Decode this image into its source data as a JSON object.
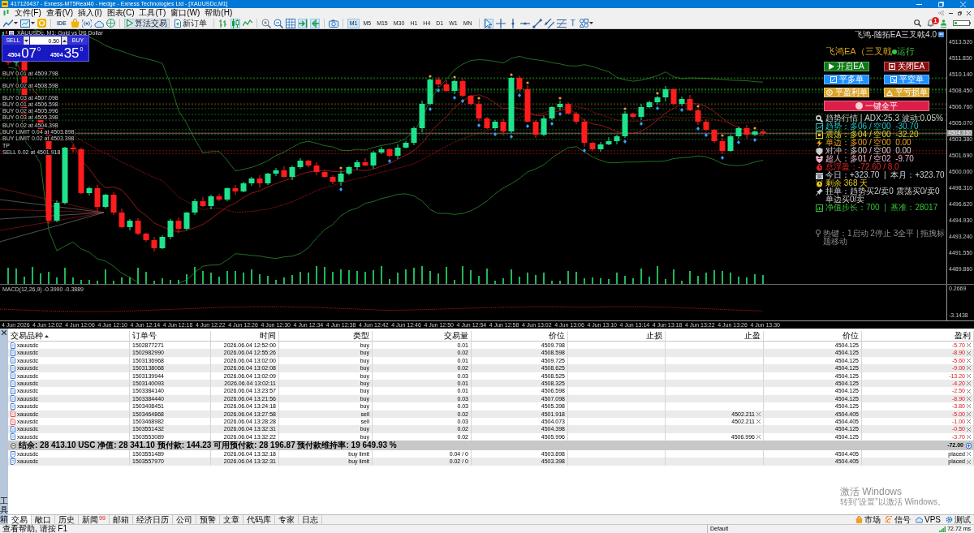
{
  "window": {
    "title": "417120437 - Exness-MT5Real40 - Hedge - Exness Technologies Ltd - [XAUUSDc,M1]"
  },
  "menu": [
    "文件(F)",
    "查看(V)",
    "插入(I)",
    "图表(C)",
    "工具(T)",
    "窗口(W)",
    "帮助(H)"
  ],
  "toolbar": {
    "ide": "IDE",
    "algo_trading": {
      "label": "算法交易",
      "on": true
    },
    "new_order": "新订单",
    "chart_modes": [
      {
        "kind": "bars",
        "selected": false
      },
      {
        "kind": "candles",
        "selected": true
      },
      {
        "kind": "line",
        "selected": false
      }
    ],
    "autoscroll": {
      "on": true
    },
    "chart_shift": {
      "on": true
    },
    "timeframes": [
      {
        "label": "M1",
        "selected": true
      },
      {
        "label": "M5",
        "selected": false
      },
      {
        "label": "M15",
        "selected": false
      },
      {
        "label": "M30",
        "selected": false
      },
      {
        "label": "H1",
        "selected": false
      },
      {
        "label": "H4",
        "selected": false
      },
      {
        "label": "D1",
        "selected": false
      },
      {
        "label": "W1",
        "selected": false
      },
      {
        "label": "MN",
        "selected": false
      }
    ],
    "draw_tools": [
      {
        "kind": "cursor",
        "selected": true
      },
      {
        "kind": "crosshair",
        "selected": false
      },
      {
        "kind": "vline",
        "selected": false
      },
      {
        "kind": "hline",
        "selected": false
      },
      {
        "kind": "trendline",
        "selected": false
      },
      {
        "kind": "channel",
        "selected": false
      },
      {
        "kind": "fibo",
        "selected": false
      }
    ],
    "text_tool": "T",
    "notifications": "1"
  },
  "chart": {
    "title": "XAUUSDc, M1: Gold vs US Dollar",
    "one_click": {
      "sell": "SELL",
      "buy": "BUY",
      "volume": "0.50",
      "bid": {
        "figure": "4504",
        "pips": "07",
        "point": "0"
      },
      "ask": {
        "figure": "4504",
        "pips": "35",
        "point": "0"
      }
    },
    "order_labels": [
      "BUY 0.01 at 4509.798",
      "BUY 0.02 at 4508.598",
      "BUY 0.03 at 4507.098",
      "BUY 0.01 at 4506.598",
      "BUY 0.02 at 4505.996",
      "BUY 0.03 at 4505.398",
      "BUY 0.02 at 4504.398",
      "BUY LIMIT 0.04 at 4503.898",
      "BUY LIMIT 0.02 at 4503.398",
      "TP",
      "SELL 0.02 at 4501.918"
    ],
    "price_axis": [
      "4513.520",
      "4511.830",
      "4510.140",
      "4508.450",
      "4506.760",
      "4505.070",
      "4503.380",
      "4501.690",
      "4500.000",
      "4498.310",
      "4496.620",
      "4494.930",
      "4493.240",
      "4491.550",
      "4489.860"
    ],
    "current_price": "4504.030",
    "time_axis": [
      "4 Jun 2026",
      "4 Jun 12:02",
      "4 Jun 12:06",
      "4 Jun 12:10",
      "4 Jun 12:14",
      "4 Jun 12:18",
      "4 Jun 12:22",
      "4 Jun 12:26",
      "4 Jun 12:30",
      "4 Jun 12:34",
      "4 Jun 12:38",
      "4 Jun 12:42",
      "4 Jun 12:46",
      "4 Jun 12:50",
      "4 Jun 12:54",
      "4 Jun 12:58",
      "4 Jun 13:02",
      "4 Jun 13:06",
      "4 Jun 13:10",
      "4 Jun 13:14",
      "4 Jun 13:18",
      "4 Jun 13:22",
      "4 Jun 13:26",
      "4 Jun 13:30"
    ],
    "macd": {
      "label": "MACD(12,26,9) -0.3990 -0.3889",
      "axis": [
        "0.2669",
        "-3.1438"
      ]
    },
    "ea_panel": {
      "caption": "飞鸿-随拓EA三叉戟4.0",
      "title": "飞鸿EA（三叉戟",
      "status": "运行",
      "buttons": [
        {
          "kind": "start",
          "label": "开启EA",
          "color": "#0c7a12"
        },
        {
          "kind": "stop",
          "label": "关闭EA",
          "color": "#8a0c0c"
        },
        {
          "kind": "close-long",
          "label": "平多单",
          "color": "#1e8fff"
        },
        {
          "kind": "close-short",
          "label": "平空单",
          "color": "#1e8fff"
        },
        {
          "kind": "close-profit",
          "label": "平盈利单",
          "color": "#d9a326"
        },
        {
          "kind": "close-loss",
          "label": "平亏损单",
          "color": "#d9a326"
        },
        {
          "kind": "close-all",
          "label": "一键全平",
          "color": "#dc1e48"
        }
      ],
      "lines": [
        {
          "kind": "search",
          "text": "趋势行情 | ADX:25.3 波动:0.05%",
          "color": "#d0d0d0"
        },
        {
          "kind": "trend",
          "text": "趋势：多06 / 空00  -30.70",
          "color": "#22c4d4"
        },
        {
          "kind": "range",
          "text": "震荡：多04 / 空00  -32.20",
          "color": "#e2d322"
        },
        {
          "kind": "bolt",
          "text": "单边：多00 / 空00  0.00",
          "color": "#f0a024"
        },
        {
          "kind": "shield",
          "text": "对冲：多00 / 空00  0.00",
          "color": "#cfcfcf"
        },
        {
          "kind": "crest",
          "text": "超人：多01 / 空02  -9.70",
          "color": "#efb6cc"
        },
        {
          "kind": "timer",
          "text": "总浮盈：-72.60 / 8.0",
          "color": "#e42222"
        },
        {
          "kind": "calendar",
          "text": "今日：+323.70  |  本月：+323.70",
          "color": "#cdd6de"
        },
        {
          "kind": "clock",
          "text": "剩余 368 天",
          "color": "#e8c824"
        },
        {
          "kind": "pin",
          "text": "挂单：趋势买2/卖0 震荡买0/卖0 单边买0/卖",
          "color": "#cfcfcf"
        },
        {
          "kind": "chart",
          "text": "净值步长：700  |  基准：28017",
          "color": "#34c234"
        }
      ],
      "hint": "热键：1启动 2停止 3全平 | 拖拽标题移动"
    }
  },
  "toolbox": {
    "label": "工具箱",
    "columns": [
      "交易品种",
      "订单号",
      "时间",
      "类型",
      "交易量",
      "价位",
      "止损",
      "止盈",
      "价位",
      "盈利"
    ],
    "rows": [
      {
        "kind": "buy",
        "symbol": "xauusdc",
        "order": "1502877271",
        "time": "2026.06.04 12:52:00",
        "type": "buy",
        "volume": "0.01",
        "price": "4509.798",
        "current": "4504.125",
        "profit": "-5.70",
        "loss": true
      },
      {
        "kind": "buy",
        "symbol": "xauusdc",
        "order": "1502982990",
        "time": "2026.06.04 12:55:26",
        "type": "buy",
        "volume": "0.02",
        "price": "4508.598",
        "current": "4504.125",
        "profit": "-8.90",
        "loss": true
      },
      {
        "kind": "buy",
        "symbol": "xauusdc",
        "order": "1503136968",
        "time": "2026.06.04 13:02:00",
        "type": "buy",
        "volume": "0.01",
        "price": "4509.725",
        "current": "4504.125",
        "profit": "-5.60",
        "loss": true
      },
      {
        "kind": "buy",
        "symbol": "xauusdc",
        "order": "1503138068",
        "time": "2026.06.04 13:02:08",
        "type": "buy",
        "volume": "0.02",
        "price": "4508.625",
        "current": "4504.125",
        "profit": "-9.00",
        "loss": true
      },
      {
        "kind": "buy",
        "symbol": "xauusdc",
        "order": "1503139944",
        "time": "2026.06.04 13:02:09",
        "type": "buy",
        "volume": "0.03",
        "price": "4508.525",
        "current": "4504.125",
        "profit": "-13.20",
        "loss": true
      },
      {
        "kind": "buy",
        "symbol": "xauusdc",
        "order": "1503140093",
        "time": "2026.06.04 13:02:11",
        "type": "buy",
        "volume": "0.01",
        "price": "4508.325",
        "current": "4504.125",
        "profit": "-4.20",
        "loss": true
      },
      {
        "kind": "buy",
        "symbol": "xauusdc",
        "order": "1503384140",
        "time": "2026.06.04 13:23:57",
        "type": "buy",
        "volume": "0.01",
        "price": "4506.598",
        "current": "4504.125",
        "profit": "-2.50",
        "loss": true
      },
      {
        "kind": "buy",
        "symbol": "xauusdc",
        "order": "1503384440",
        "time": "2026.06.04 13:21:56",
        "type": "buy",
        "volume": "0.03",
        "price": "4507.098",
        "current": "4504.125",
        "profit": "-8.90",
        "loss": true
      },
      {
        "kind": "buy",
        "symbol": "xauusdc",
        "order": "1503408451",
        "time": "2026.06.04 13:24:18",
        "type": "buy",
        "volume": "0.03",
        "price": "4505.398",
        "current": "4504.125",
        "profit": "-3.80",
        "loss": true
      },
      {
        "kind": "sell",
        "symbol": "xauusdc",
        "order": "1503464868",
        "time": "2026.06.04 13:27:58",
        "type": "sell",
        "volume": "0.02",
        "price": "4501.918",
        "tp": "4502.211",
        "current": "4504.405",
        "profit": "-5.00",
        "loss": true
      },
      {
        "kind": "sell",
        "symbol": "xauusdc",
        "order": "1503468982",
        "time": "2026.06.04 13:28:28",
        "type": "sell",
        "volume": "0.03",
        "price": "4504.073",
        "tp": "4502.211",
        "current": "4504.405",
        "profit": "-1.00",
        "loss": true
      },
      {
        "kind": "buy",
        "symbol": "xauusdc",
        "order": "1503551432",
        "time": "2026.06.04 13:32:31",
        "type": "buy",
        "volume": "0.02",
        "price": "4504.398",
        "current": "4504.125",
        "profit": "-0.50",
        "loss": true
      },
      {
        "kind": "buy",
        "symbol": "xauusdc",
        "order": "1503553089",
        "time": "2026.06.04 13:32:22",
        "type": "buy",
        "volume": "0.02",
        "price": "4505.996",
        "tp": "4506.996",
        "current": "4504.125",
        "profit": "-3.70",
        "loss": true
      }
    ],
    "summary": {
      "text": "结余: 28 413.10 USC  净值: 28 341.10  预付款: 144.23  可用预付款: 28 196.87  预付款维持率: 19 649.93 %",
      "profit": "-72.00"
    },
    "pending": [
      {
        "kind": "pending",
        "symbol": "xauusdc",
        "order": "1503551489",
        "time": "2026.06.04 13:32:18",
        "type": "buy limit",
        "volume": "0.04 / 0",
        "price": "4503.898",
        "current": "4504.405",
        "profit": "placed",
        "loss": false
      },
      {
        "kind": "pending",
        "symbol": "xauusdc",
        "order": "1503557970",
        "time": "2026.06.04 13:32:31",
        "type": "buy limit",
        "volume": "0.02 / 0",
        "price": "4503.398",
        "current": "4504.405",
        "profit": "placed",
        "loss": false
      }
    ],
    "activation": {
      "title": "激活 Windows",
      "hint": "转到“设置”以激活 Windows。"
    },
    "tabs": [
      {
        "label": "交易",
        "selected": true
      },
      {
        "label": "敞口",
        "selected": false
      },
      {
        "label": "历史",
        "selected": false
      },
      {
        "label": "新闻",
        "selected": false,
        "badge": "99"
      },
      {
        "label": "邮箱",
        "selected": false
      },
      {
        "label": "经济日历",
        "selected": false
      },
      {
        "label": "公司",
        "selected": false
      },
      {
        "label": "预警",
        "selected": false
      },
      {
        "label": "文章",
        "selected": false
      },
      {
        "label": "代码库",
        "selected": false
      },
      {
        "label": "专家",
        "selected": false
      },
      {
        "label": "日志",
        "selected": false
      }
    ],
    "services": [
      {
        "kind": "market",
        "label": "市场"
      },
      {
        "kind": "signals",
        "label": "信号"
      },
      {
        "kind": "vps",
        "label": "VPS"
      },
      {
        "kind": "tester",
        "label": "测试"
      }
    ]
  },
  "status_bar": {
    "help": "查看帮助, 请按 F1",
    "profile": "Default",
    "ping": "72.72 ms"
  }
}
